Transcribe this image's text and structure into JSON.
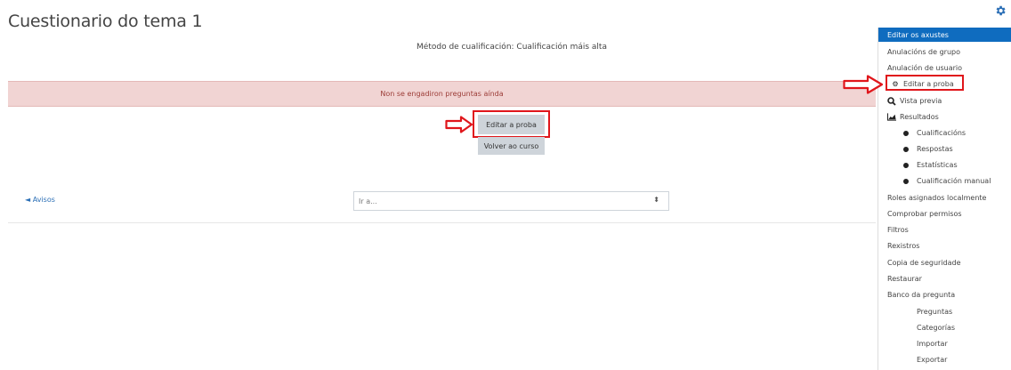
{
  "page": {
    "title": "Cuestionario do tema 1"
  },
  "quiz": {
    "grading_method": "Método de cualificación: Cualificación máis alta",
    "alert": "Non se engadiron preguntas aínda",
    "edit_button": "Editar a proba",
    "back_button": "Volver ao curso"
  },
  "navigation": {
    "prev_link": "◄ Avisos",
    "jump_placeholder": "Ir a..."
  },
  "settings_menu": {
    "items": [
      {
        "label": "Editar os axustes",
        "active": true
      },
      {
        "label": "Anulacións de grupo"
      },
      {
        "label": "Anulación de usuario"
      },
      {
        "label": "Editar a proba",
        "icon": "gear-icon"
      },
      {
        "label": "Vista previa",
        "icon": "magnifier-icon"
      },
      {
        "label": "Resultados",
        "icon": "chart-icon"
      },
      {
        "label": "Cualificacións",
        "level": 2
      },
      {
        "label": "Respostas",
        "level": 2
      },
      {
        "label": "Estatísticas",
        "level": 2
      },
      {
        "label": "Cualificación manual",
        "level": 2
      },
      {
        "label": "Roles asignados localmente"
      },
      {
        "label": "Comprobar permisos"
      },
      {
        "label": "Filtros"
      },
      {
        "label": "Rexistros"
      },
      {
        "label": "Copia de seguridade"
      },
      {
        "label": "Restaurar"
      },
      {
        "label": "Banco da pregunta"
      },
      {
        "label": "Preguntas",
        "level": 3
      },
      {
        "label": "Categorías",
        "level": 3
      },
      {
        "label": "Importar",
        "level": 3
      },
      {
        "label": "Exportar",
        "level": 3
      }
    ]
  },
  "colors": {
    "accent": "#0f6cbf",
    "alert_bg": "#f1d4d3",
    "alert_text": "#9b3b36",
    "annotation_red": "#e0161b"
  }
}
